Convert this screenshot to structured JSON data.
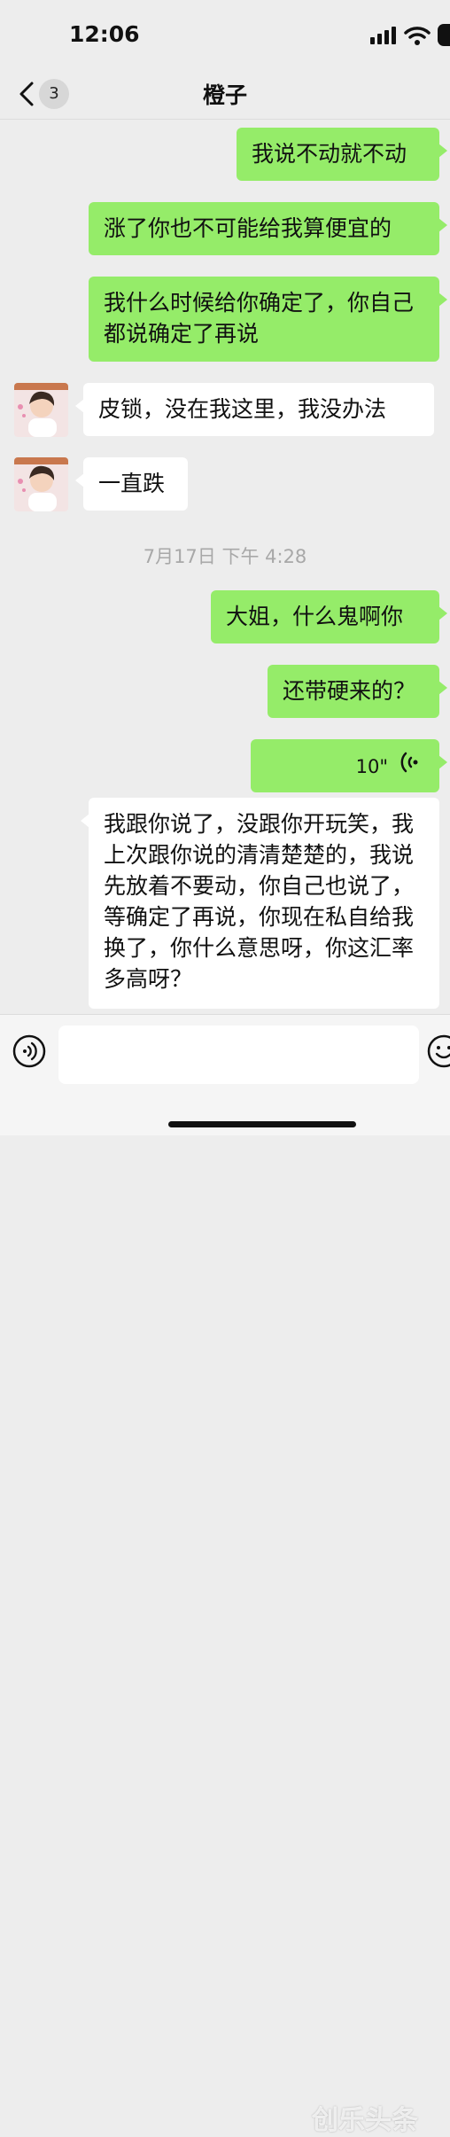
{
  "status_bar": {
    "time": "12:06"
  },
  "nav": {
    "back_badge": "3",
    "title": "橙子"
  },
  "messages": [
    {
      "text": "我说不动就不动"
    },
    {
      "text": "涨了你也不可能给我算便宜的"
    },
    {
      "text": "我什么时候给你确定了，你自己都说确定了再说"
    },
    {
      "text": "皮锁，没在我这里，我没办法"
    },
    {
      "text": "一直跌"
    },
    {
      "text": "大姐，什么鬼啊你"
    },
    {
      "text": "还带硬来的？"
    },
    {
      "voice_duration": "10\""
    },
    {
      "text": "我跟你说了，没跟你开玩笑，我上次跟你说的清清楚楚的，我说先放着不要动，你自己也说了，等确定了再说，你现在私自给我换了，你什么意思呀，你这汇率多高呀？"
    }
  ],
  "timestamp": "7月17日 下午 4:28",
  "input": {
    "placeholder": ""
  },
  "watermark": "创乐头条",
  "colors": {
    "outgoing_bubble": "#95ec69",
    "incoming_bubble": "#ffffff",
    "background": "#ededed"
  }
}
